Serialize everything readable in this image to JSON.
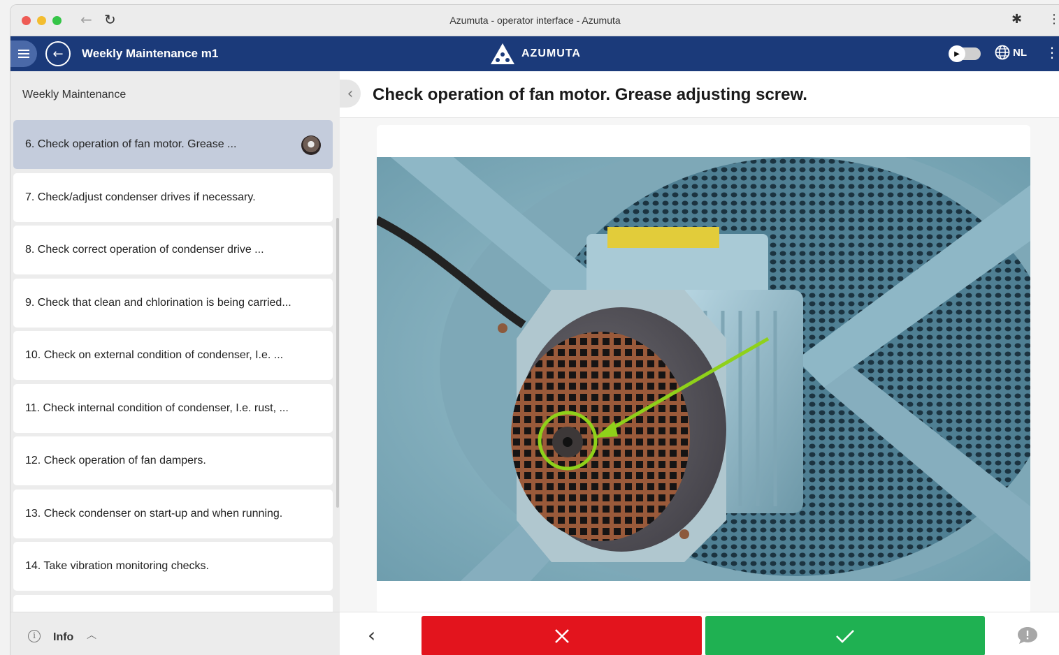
{
  "browser": {
    "window_title": "Azumuta - operator interface - Azumuta",
    "back_glyph": "←",
    "reload_glyph": "↻",
    "extensions_glyph": "✱",
    "more_glyph": "⋮"
  },
  "appbar": {
    "title": "Weekly Maintenance m1",
    "brand": "AZUMUTA",
    "language": "NL",
    "back_glyph": "←",
    "more_glyph": "⋮",
    "background_color": "#1b3a7a"
  },
  "sidebar": {
    "heading": "Weekly Maintenance",
    "steps": [
      {
        "label": "6. Check operation of fan motor.  Grease ...",
        "active": true,
        "has_thumbnail": true
      },
      {
        "label": "7. Check/adjust condenser drives if necessary."
      },
      {
        "label": "8. Check correct operation of condenser drive ..."
      },
      {
        "label": "9. Check that clean and chlorination is being carried..."
      },
      {
        "label": "10. Check on external condition of condenser, I.e. ..."
      },
      {
        "label": "11. Check internal condition of condenser, I.e. rust, ..."
      },
      {
        "label": "12. Check operation of fan dampers."
      },
      {
        "label": "13. Check condenser on start-up and when running."
      },
      {
        "label": "14. Take vibration monitoring checks."
      },
      {
        "label": ""
      }
    ],
    "footer": {
      "info_label": "Info",
      "info_glyph": "i",
      "chevron_glyph": "︿"
    }
  },
  "main": {
    "collapse_glyph": "‹",
    "step_title": "Check operation of fan motor.  Grease adjusting screw.",
    "actions": {
      "prev_glyph": "‹",
      "reject_color": "#e3141d",
      "accept_color": "#1fb152"
    }
  },
  "icons": [
    "menu-icon",
    "back-arrow-icon",
    "azumuta-logo-icon",
    "toggle-icon",
    "globe-icon",
    "more-vert-icon",
    "info-icon",
    "chevron-up-icon",
    "chevron-left-icon",
    "close-icon",
    "check-icon",
    "comment-icon",
    "reload-icon",
    "puzzle-icon"
  ]
}
